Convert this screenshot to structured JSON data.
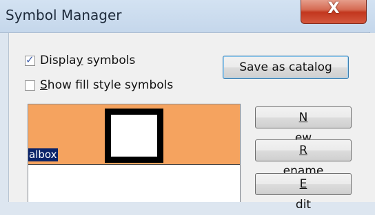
{
  "window": {
    "title": "Symbol Manager",
    "close_label": "X"
  },
  "options": {
    "display_symbols": {
      "label_pre": "Displa",
      "label_key": "y",
      "label_post": " symbols",
      "checked": true
    },
    "show_fill_style": {
      "label_pre": "",
      "label_key": "S",
      "label_post": "how fill style symbols",
      "checked": false
    }
  },
  "buttons": {
    "save_as_catalog": "Save as catalog",
    "new": {
      "key": "N",
      "rest": "ew"
    },
    "rename": {
      "key": "R",
      "rest": "ename"
    },
    "edit": {
      "key": "E",
      "rest": "dit"
    }
  },
  "symbol_list": {
    "items": [
      {
        "name": "albox",
        "selected": true,
        "fill_color": "#f5a35f"
      }
    ]
  }
}
